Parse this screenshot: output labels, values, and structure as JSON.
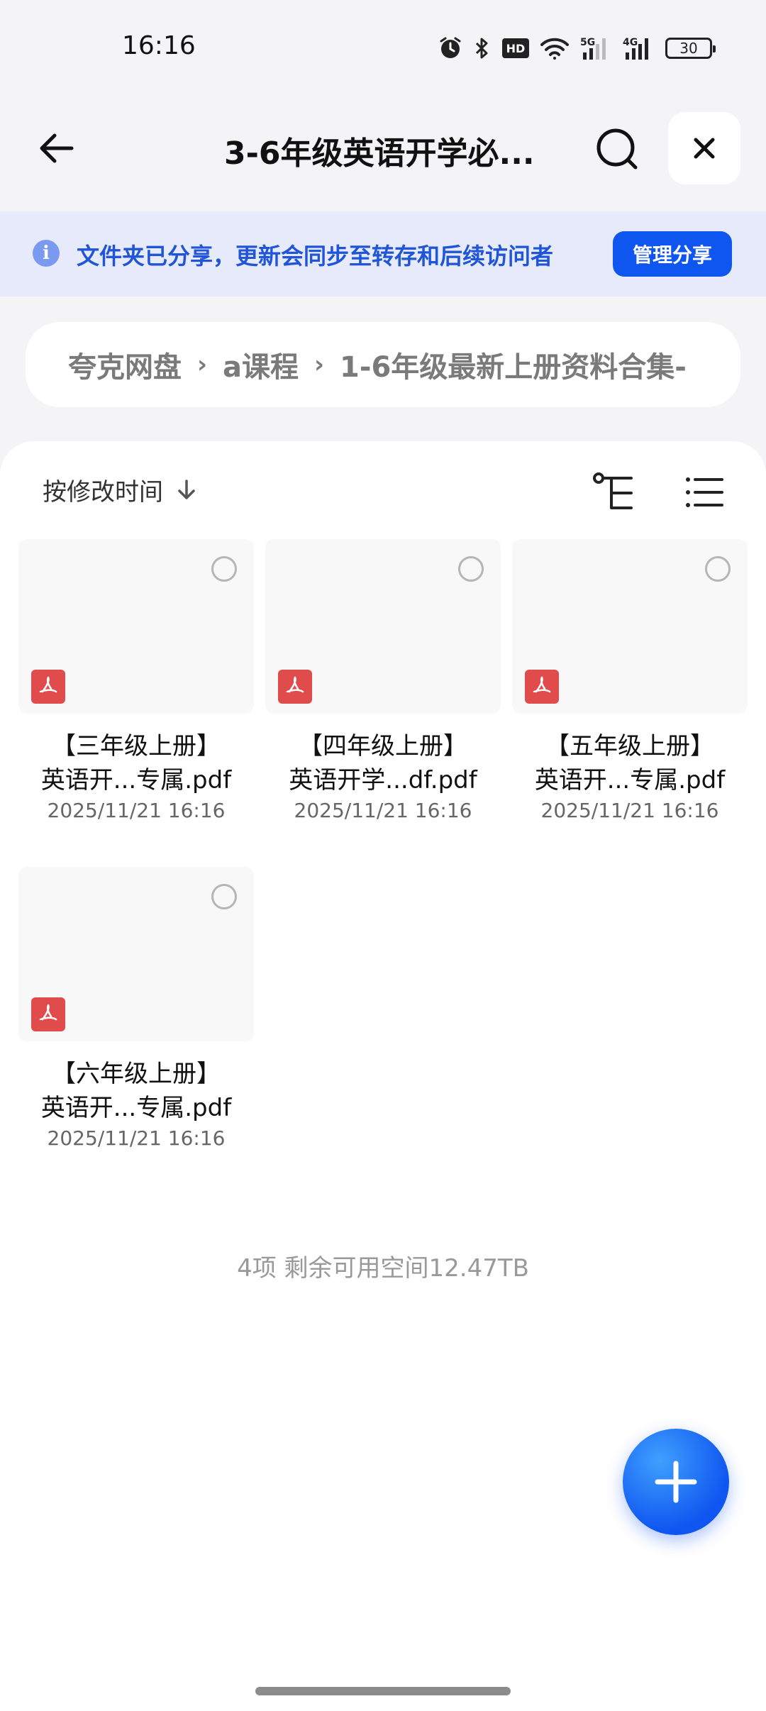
{
  "status_bar": {
    "time": "16:16",
    "hd_label": "HD",
    "net1": "5G",
    "net2": "4G",
    "battery": "30",
    "icons": [
      "alarm-icon",
      "bluetooth-icon",
      "hd-voice-icon",
      "wifi-icon",
      "signal-5g-icon",
      "signal-4g-icon",
      "battery-icon"
    ]
  },
  "header": {
    "title": "3-6年级英语开学必...",
    "back_icon": "arrow-left-icon",
    "search_icon": "search-icon",
    "close_icon": "close-icon"
  },
  "share_banner": {
    "info_glyph": "i",
    "text": "文件夹已分享，更新会同步至转存和后续访问者",
    "button_label": "管理分享"
  },
  "breadcrumb": {
    "items": [
      "夸克网盘",
      "a课程",
      "1-6年级最新上册资料合集-"
    ],
    "separator": "›"
  },
  "toolbar": {
    "sort_label": "按修改时间",
    "sort_icon": "arrow-down-icon",
    "tree_icon": "tree-view-icon",
    "list_icon": "list-view-icon"
  },
  "files": [
    {
      "name_line1": "【三年级上册】",
      "name_line2": "英语开...专属.pdf",
      "date": "2025/11/21 16:16",
      "type_icon": "pdf-icon"
    },
    {
      "name_line1": "【四年级上册】",
      "name_line2": "英语开学...df.pdf",
      "date": "2025/11/21 16:16",
      "type_icon": "pdf-icon"
    },
    {
      "name_line1": "【五年级上册】",
      "name_line2": "英语开...专属.pdf",
      "date": "2025/11/21 16:16",
      "type_icon": "pdf-icon"
    },
    {
      "name_line1": "【六年级上册】",
      "name_line2": "英语开...专属.pdf",
      "date": "2025/11/21 16:16",
      "type_icon": "pdf-icon"
    }
  ],
  "footer": {
    "summary": "4项 剩余可用空间12.47TB"
  },
  "fab": {
    "icon": "plus-icon"
  },
  "colors": {
    "accent": "#0f55f0",
    "banner_bg": "#e6eafb",
    "banner_text": "#1f55d6",
    "pdf_red": "#e04b4b"
  }
}
